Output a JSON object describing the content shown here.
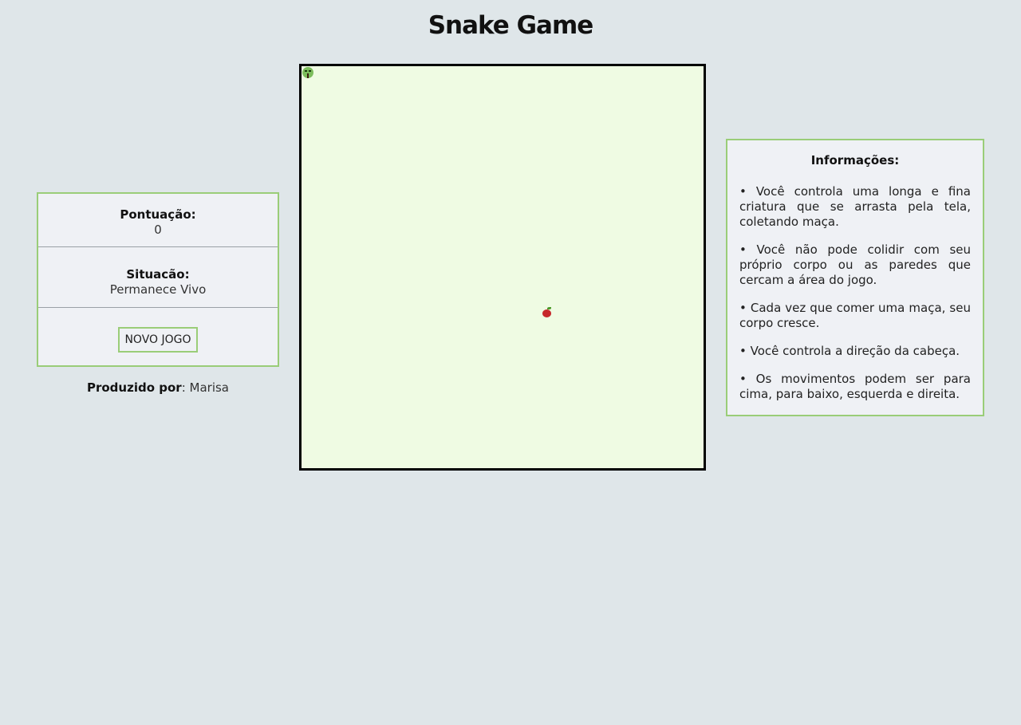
{
  "page": {
    "title": "Snake Game"
  },
  "status": {
    "score_label": "Pontuação:",
    "score_value": "0",
    "state_label": "Situacão:",
    "state_value": "Permanece Vivo",
    "new_game_label": "NOVO JOGO"
  },
  "credits": {
    "label": "Produzido por",
    "separator": ": ",
    "author": "Marisa"
  },
  "board": {
    "snake_head_icon": "snake-head-icon",
    "apple_icon": "apple-icon",
    "colors": {
      "background": "#effbe3",
      "border": "#000000",
      "snake": "#7cbd5c",
      "apple": "#c6282b"
    }
  },
  "info": {
    "title": "Informações:",
    "items": [
      "• Você controla uma longa e fina criatura que se arrasta pela tela, coletando maça.",
      "• Você não pode colidir com seu próprio corpo ou as paredes que cercam a área do jogo.",
      "• Cada vez que comer uma maça, seu corpo cresce.",
      "• Você controla a direção da cabeça.",
      "• Os movimentos podem ser para cima, para baixo, esquerda e direita."
    ]
  },
  "theme": {
    "page_background": "#dfe6e9",
    "panel_background": "#eff1f5",
    "accent_border": "#9acd78"
  }
}
